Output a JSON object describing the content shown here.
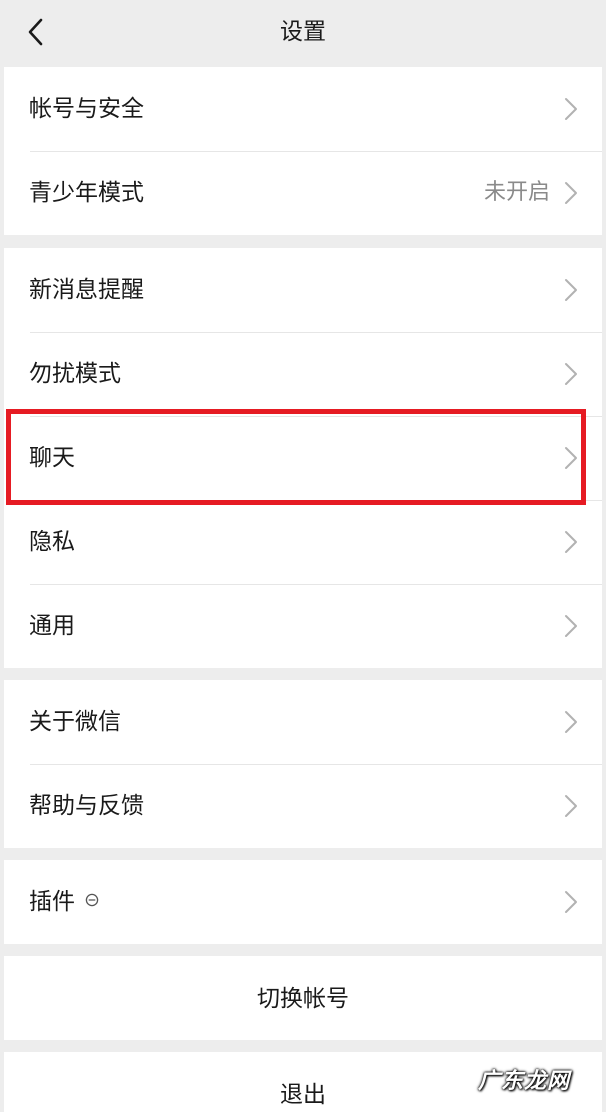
{
  "header": {
    "title": "设置",
    "back_icon": "chevron-left-icon"
  },
  "group1": [
    {
      "label": "帐号与安全",
      "value": ""
    },
    {
      "label": "青少年模式",
      "value": "未开启"
    }
  ],
  "group2": [
    {
      "label": "新消息提醒"
    },
    {
      "label": "勿扰模式"
    },
    {
      "label": "聊天"
    },
    {
      "label": "隐私"
    },
    {
      "label": "通用"
    }
  ],
  "group3": [
    {
      "label": "关于微信"
    },
    {
      "label": "帮助与反馈"
    }
  ],
  "group4": [
    {
      "label": "插件",
      "icon": "plugin-status-icon"
    }
  ],
  "actions": {
    "switch_account": "切换帐号",
    "logout": "退出"
  },
  "highlight": {
    "target": "聊天",
    "color": "#e61b23"
  },
  "watermark": "广东龙网",
  "colors": {
    "background": "#ededed",
    "cell": "#ffffff",
    "secondary_text": "#8a8a8a"
  }
}
